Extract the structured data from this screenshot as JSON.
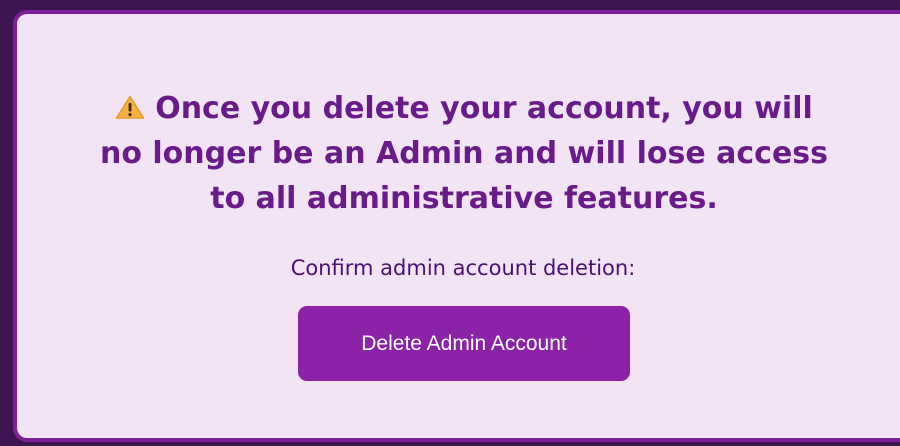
{
  "dialog": {
    "warning_icon": "warning-triangle-icon",
    "warning_text": "Once you delete your account, you will no longer be an Admin and will lose access to all administrative features.",
    "confirm_label": "Confirm admin account deletion:",
    "delete_button_label": "Delete Admin Account"
  },
  "colors": {
    "panel_background": "#f2e3f5",
    "panel_border": "#7e1f9a",
    "outer_background": "#3b1650",
    "warning_text": "#6a1b8a",
    "confirm_text": "#4a1072",
    "button_background": "#8b22a8",
    "button_text": "#ffffff",
    "icon_fill": "#f5b041"
  }
}
